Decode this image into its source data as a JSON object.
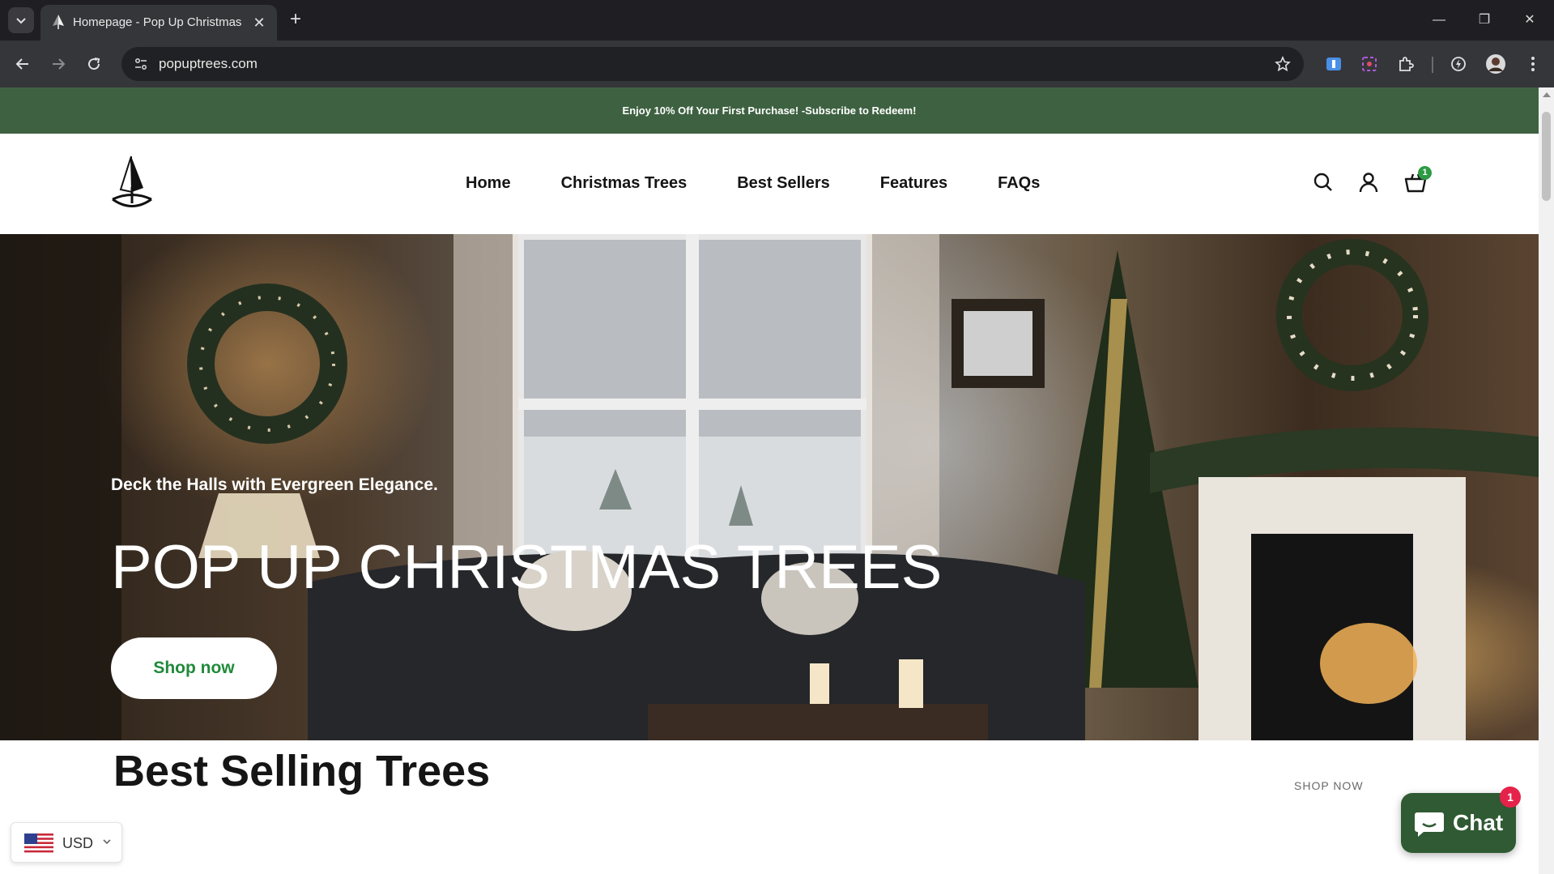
{
  "browser": {
    "tab_title": "Homepage - Pop Up Christmas",
    "url": "popuptrees.com",
    "new_tab_symbol": "+",
    "tab_close_symbol": "✕",
    "window_controls": {
      "minimize": "—",
      "restore": "❐",
      "close": "✕"
    }
  },
  "announcement": {
    "text": "Enjoy 10% Off Your First Purchase! -Subscribe to Redeem!"
  },
  "header": {
    "nav": [
      {
        "label": "Home"
      },
      {
        "label": "Christmas Trees"
      },
      {
        "label": "Best Sellers"
      },
      {
        "label": "Features"
      },
      {
        "label": "FAQs"
      }
    ],
    "cart_count": "1"
  },
  "hero": {
    "subtitle": "Deck the Halls with Evergreen Elegance.",
    "title": "POP UP CHRISTMAS TREES",
    "button_label": "Shop now"
  },
  "best_selling": {
    "title": "Best Selling Trees",
    "link_label": "SHOP NOW"
  },
  "currency": {
    "code": "USD"
  },
  "chat": {
    "label": "Chat",
    "badge": "1"
  },
  "colors": {
    "announcement_bg": "#3e6241",
    "accent_green": "#1f8a3a",
    "chat_bg": "#2f5a33",
    "badge_red": "#e5224a",
    "cart_badge": "#2e9b44"
  },
  "icons": {
    "header": [
      "search-icon",
      "account-icon",
      "cart-icon"
    ],
    "browser": [
      "back-icon",
      "forward-icon",
      "reload-icon",
      "site-info-icon",
      "bookmark-star-icon",
      "extension-icon",
      "profile-avatar",
      "menu-icon"
    ]
  }
}
